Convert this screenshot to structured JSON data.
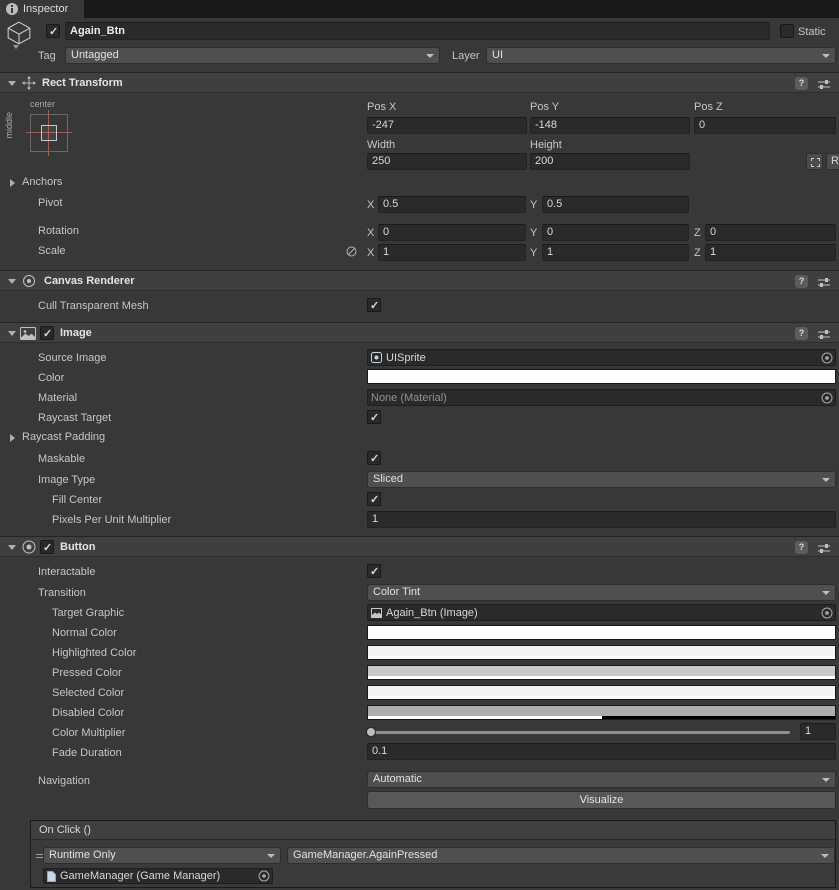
{
  "tab": {
    "label": "Inspector"
  },
  "gameobject": {
    "name": "Again_Btn",
    "static_label": "Static",
    "tag_label": "Tag",
    "tag_value": "Untagged",
    "layer_label": "Layer",
    "layer_value": "UI"
  },
  "rect_transform": {
    "title": "Rect Transform",
    "anchor_horizontal": "center",
    "anchor_vertical": "middle",
    "pos_x_label": "Pos X",
    "pos_y_label": "Pos Y",
    "pos_z_label": "Pos Z",
    "pos_x": "-247",
    "pos_y": "-148",
    "pos_z": "0",
    "width_label": "Width",
    "height_label": "Height",
    "width": "250",
    "height": "200",
    "anchors_label": "Anchors",
    "pivot_label": "Pivot",
    "pivot_x": "0.5",
    "pivot_y": "0.5",
    "rotation_label": "Rotation",
    "rotation_x": "0",
    "rotation_y": "0",
    "rotation_z": "0",
    "scale_label": "Scale",
    "scale_x": "1",
    "scale_y": "1",
    "scale_z": "1",
    "axis_x": "X",
    "axis_y": "Y",
    "axis_z": "Z",
    "raw_edit_label": "R"
  },
  "canvas_renderer": {
    "title": "Canvas Renderer",
    "cull_label": "Cull Transparent Mesh"
  },
  "image": {
    "title": "Image",
    "source_image_label": "Source Image",
    "source_image_value": "UISprite",
    "color_label": "Color",
    "color_value": "#FFFFFF",
    "material_label": "Material",
    "material_value": "None (Material)",
    "raycast_target_label": "Raycast Target",
    "raycast_padding_label": "Raycast Padding",
    "maskable_label": "Maskable",
    "image_type_label": "Image Type",
    "image_type_value": "Sliced",
    "fill_center_label": "Fill Center",
    "ppu_label": "Pixels Per Unit Multiplier",
    "ppu_value": "1"
  },
  "button": {
    "title": "Button",
    "interactable_label": "Interactable",
    "transition_label": "Transition",
    "transition_value": "Color Tint",
    "target_graphic_label": "Target Graphic",
    "target_graphic_value": "Again_Btn (Image)",
    "normal_color_label": "Normal Color",
    "highlighted_color_label": "Highlighted Color",
    "pressed_color_label": "Pressed Color",
    "selected_color_label": "Selected Color",
    "disabled_color_label": "Disabled Color",
    "color_multiplier_label": "Color Multiplier",
    "color_multiplier_value": "1",
    "fade_duration_label": "Fade Duration",
    "fade_duration_value": "0.1",
    "navigation_label": "Navigation",
    "navigation_value": "Automatic",
    "visualize_label": "Visualize",
    "colors": {
      "normal": "#FFFFFF",
      "highlighted": "#F4F4F4",
      "pressed": "#C8C8C8",
      "selected": "#F4F4F4",
      "disabled": "#ADADAD",
      "disabled_alpha_percent": 50
    }
  },
  "on_click": {
    "title": "On Click ()",
    "mode_value": "Runtime Only",
    "function_value": "GameManager.AgainPressed",
    "target_value": "GameManager (Game Manager)"
  },
  "icons": {
    "help": "?"
  }
}
